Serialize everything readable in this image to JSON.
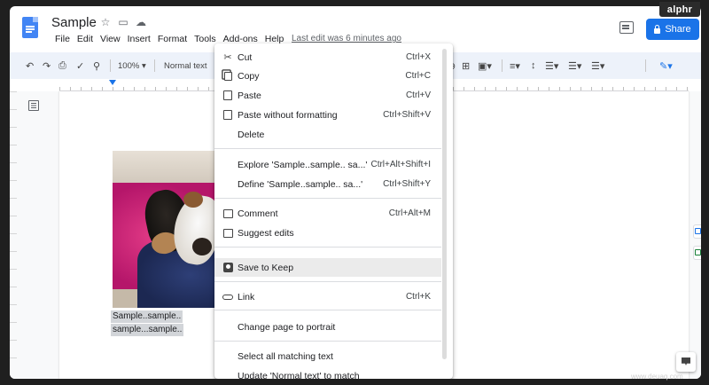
{
  "doc": {
    "title": "Sample",
    "last_edit": "Last edit was 6 minutes ago"
  },
  "menubar": [
    "File",
    "Edit",
    "View",
    "Insert",
    "Format",
    "Tools",
    "Add-ons",
    "Help"
  ],
  "share_label": "Share",
  "badge": "alphr",
  "toolbar": {
    "zoom": "100%",
    "style": "Normal text"
  },
  "caption": {
    "line1": "Sample..sample..",
    "line2": "sample...sample.."
  },
  "context_menu": {
    "cut": {
      "label": "Cut",
      "shortcut": "Ctrl+X"
    },
    "copy": {
      "label": "Copy",
      "shortcut": "Ctrl+C"
    },
    "paste": {
      "label": "Paste",
      "shortcut": "Ctrl+V"
    },
    "paste_plain": {
      "label": "Paste without formatting",
      "shortcut": "Ctrl+Shift+V"
    },
    "delete": {
      "label": "Delete"
    },
    "explore": {
      "label": "Explore 'Sample..sample.. sa...'",
      "shortcut": "Ctrl+Alt+Shift+I"
    },
    "define": {
      "label": "Define 'Sample..sample.. sa...'",
      "shortcut": "Ctrl+Shift+Y"
    },
    "comment": {
      "label": "Comment",
      "shortcut": "Ctrl+Alt+M"
    },
    "suggest": {
      "label": "Suggest edits"
    },
    "keep": {
      "label": "Save to Keep"
    },
    "link": {
      "label": "Link",
      "shortcut": "Ctrl+K"
    },
    "portrait": {
      "label": "Change page to portrait"
    },
    "select_all": {
      "label": "Select all matching text"
    },
    "update_style": {
      "label": "Update 'Normal text' to match"
    }
  },
  "watermark": "www.deuaq.com"
}
